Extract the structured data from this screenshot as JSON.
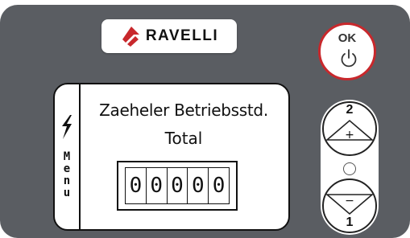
{
  "brand": {
    "name": "RAVELLI",
    "accent_color": "#c8282c",
    "logo_icon": "ravelli-flame-logo"
  },
  "display": {
    "menu_label": "Menu",
    "menu_icon": "lightning-bolt-icon",
    "line1": "Zaeheler Betriebsstd.",
    "line2": "Total",
    "counter_digits": [
      "0",
      "0",
      "0",
      "0",
      "0"
    ]
  },
  "buttons": {
    "ok_label": "OK",
    "power_icon": "power-icon",
    "up_number": "2",
    "up_symbol": "+",
    "down_number": "1",
    "down_symbol": "−"
  }
}
